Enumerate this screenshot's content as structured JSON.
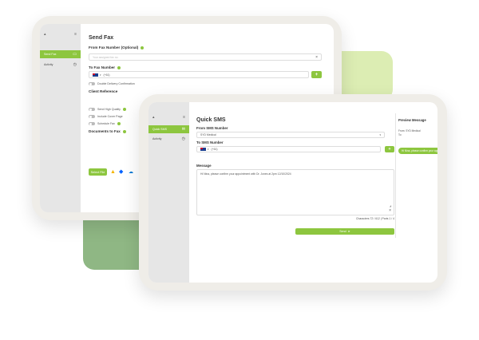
{
  "back_window": {
    "sidebar": {
      "top_icon_left": "▴",
      "top_icon_right": "≡",
      "items": [
        {
          "label": "Send Fax",
          "icon": "fax-icon",
          "active": true
        },
        {
          "label": "Activity",
          "icon": "clock-icon",
          "active": false
        }
      ]
    },
    "title": "Send Fax",
    "from_label": "From Fax Number (Optional)",
    "from_placeholder": "Your assigned fax no.",
    "from_clear": "×",
    "to_label": "To Fax Number",
    "to_code": "(+61)",
    "to_plus": "+",
    "double_delivery": "Double Delivery Confirmation",
    "client_reference_label": "Client Reference",
    "options": [
      "Send High Quality",
      "Include Cover Page",
      "Schedule Fax"
    ],
    "documents_label": "Documents to Fax",
    "select_file": "Select File",
    "cloud_icons": [
      "google-drive-icon",
      "dropbox-icon",
      "onedrive-icon"
    ]
  },
  "front_window": {
    "sidebar": {
      "top_icon_left": "▴",
      "top_icon_right": "≡",
      "items": [
        {
          "label": "Quick SMS",
          "icon": "sms-icon",
          "active": true
        },
        {
          "label": "Activity",
          "icon": "clock-icon",
          "active": false
        }
      ]
    },
    "title": "Quick SMS",
    "from_label": "From SMS Number",
    "from_value": "SYD Medical",
    "to_label": "To SMS Number",
    "to_code": "(+61)",
    "to_plus": "+",
    "message_label": "Message",
    "message_text": "Hi Nina, please confirm your appointment with Dr. Jones at 2pm 12/10/2024",
    "characters": "Characters 72 / 612 | Parts 1 / 4",
    "send_label": "Send",
    "preview": {
      "title": "Preview Message",
      "from": "From: SYD Medical",
      "to": "To:",
      "bubble": "Hi Nina, please confirm your appoint..."
    }
  },
  "colors": {
    "accent": "#8dc63f",
    "frame": "#efede8",
    "sidebar": "#e6e6e6",
    "blob_light": "#dcedb3",
    "blob_dark": "#8fb784"
  }
}
